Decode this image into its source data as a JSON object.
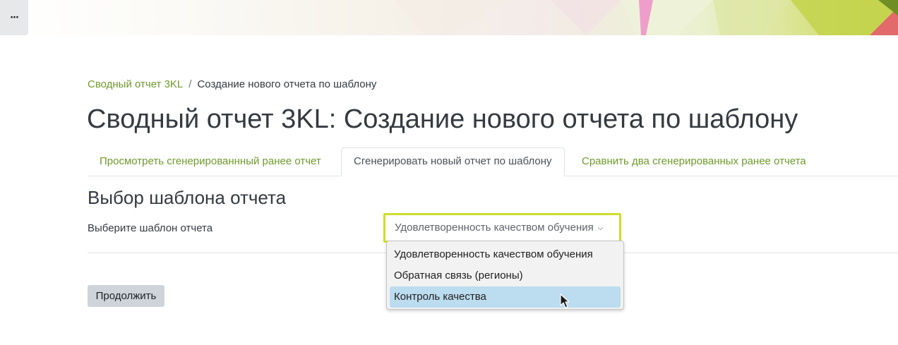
{
  "header": {
    "menu_label": "···"
  },
  "breadcrumb": {
    "parent": "Сводный отчет 3KL",
    "separator": "/",
    "current": "Создание нового отчета по шаблону"
  },
  "page_title": "Сводный отчет 3KL: Создание нового отчета по шаблону",
  "tabs": [
    {
      "label": "Просмотреть сгенерированнный ранее отчет",
      "active": false
    },
    {
      "label": "Сгенерировать новый отчет по шаблону",
      "active": true
    },
    {
      "label": "Сравнить два сгенерированных ранее отчета",
      "active": false
    }
  ],
  "form": {
    "section_title": "Выбор шаблона отчета",
    "template_label": "Выберите шаблон отчета",
    "template_value": "Удовлетворенность качеством обучения",
    "template_options": [
      "Удовлетворенность качеством обучения",
      "Обратная связь (регионы)",
      "Контроль качества"
    ],
    "highlighted_option": "Контроль качества",
    "continue_label": "Продолжить"
  },
  "colors": {
    "link": "#6f9a2b",
    "focus_border": "#cfdc2c",
    "option_highlight": "#bcdcef",
    "button_bg": "#ced4da"
  },
  "icons": {
    "menu": "ellipsis-icon",
    "select_chevron": "chevron-down-icon",
    "cursor": "mouse-pointer-icon"
  }
}
